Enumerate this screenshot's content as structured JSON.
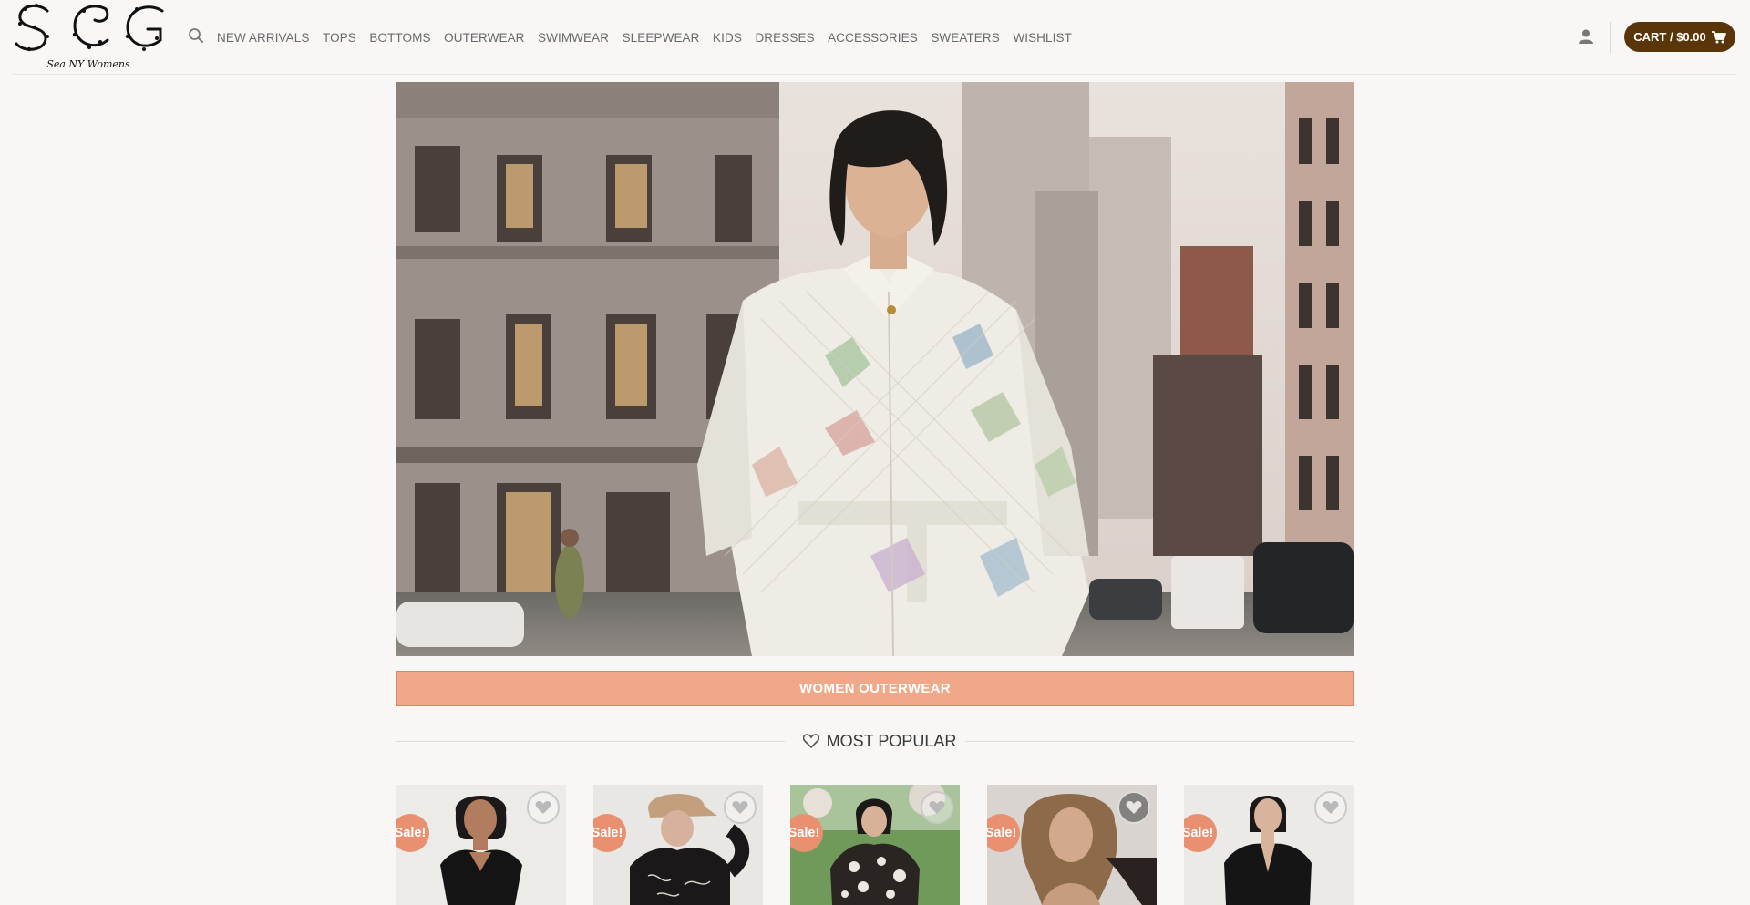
{
  "brand": {
    "caption": "Sea NY Womens"
  },
  "header": {
    "search_icon": "search-icon",
    "nav": [
      "NEW ARRIVALS",
      "TOPS",
      "BOTTOMS",
      "OUTERWEAR",
      "SWIMWEAR",
      "SLEEPWEAR",
      "KIDS",
      "DRESSES",
      "ACCESSORIES",
      "SWEATERS",
      "WISHLIST"
    ],
    "account_icon": "user-icon",
    "cart_label": "CART / $0.00",
    "cart_icon": "shopping-cart-icon"
  },
  "hero": {
    "banner_label": "WOMEN OUTERWEAR"
  },
  "section": {
    "title": "MOST POPULAR",
    "icon": "heart-outline-icon"
  },
  "products": [
    {
      "badge": "Sale!",
      "wishlist_icon": "heart-icon"
    },
    {
      "badge": "Sale!",
      "wishlist_icon": "heart-icon"
    },
    {
      "badge": "Sale!",
      "wishlist_icon": "heart-icon"
    },
    {
      "badge": "Sale!",
      "wishlist_icon": "heart-icon"
    },
    {
      "badge": "Sale!",
      "wishlist_icon": "heart-icon"
    }
  ],
  "colors": {
    "cart": "#5a3509",
    "banner": "#f0a889",
    "sale_badge": "#e8906f",
    "background": "#f8f7f5"
  }
}
